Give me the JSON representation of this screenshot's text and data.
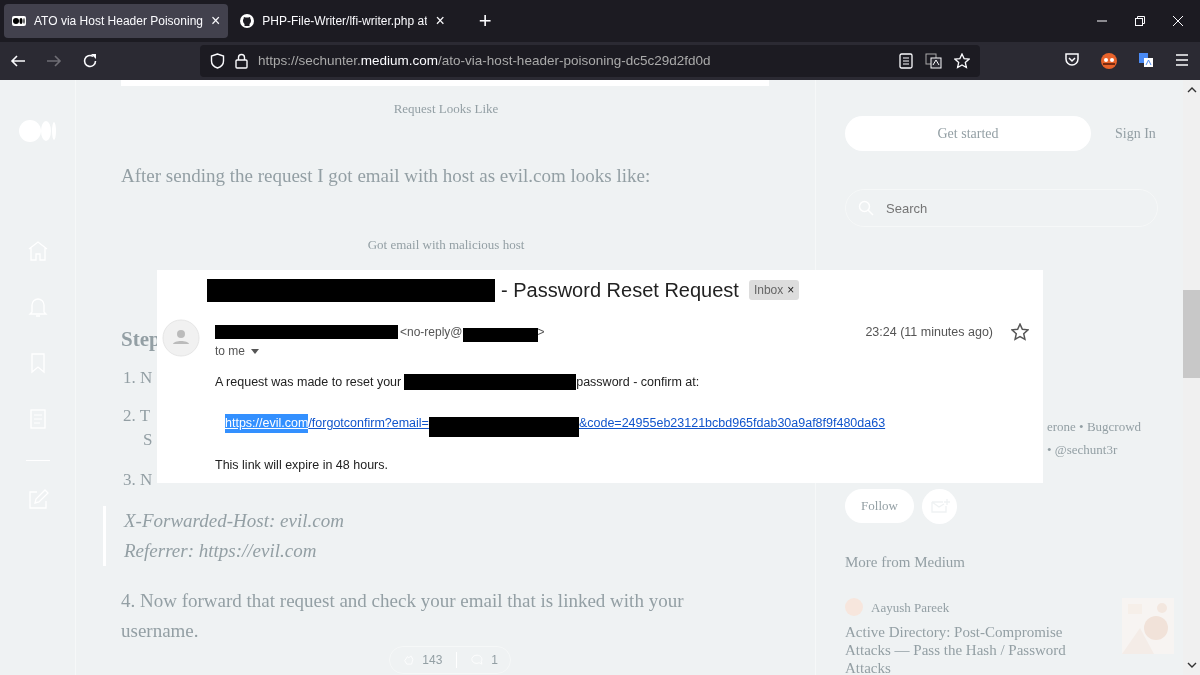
{
  "browser": {
    "tabs": [
      {
        "title": "ATO via Host Header Poisoning",
        "selected": true,
        "close": "×"
      },
      {
        "title": "PHP-File-Writer/lfi-writer.php at",
        "selected": false,
        "close": "×"
      }
    ],
    "new_tab": "+",
    "forward_disabled": true,
    "address": {
      "start": "https://sechunter.",
      "domain": "medium.com",
      "path": "/ato-via-host-header-poisoning-dc5c29d2fd0d"
    }
  },
  "article": {
    "caption_1": "Request Looks Like",
    "paragraph_1": "After sending the request I got email with host as evil.com looks like:",
    "caption_2": "Got email with malicious host",
    "heading_fragment": "Step",
    "list_fragments": [
      "1. N",
      "2. T",
      "S",
      "3. N"
    ],
    "blockquote": [
      "X-Forwarded-Host: evil.com",
      "Referrer: https://evil.com"
    ],
    "paragraph_2": "4. Now forward that request and check your email that is linked with your username.",
    "claps": "143",
    "responses": "1"
  },
  "email": {
    "subject": "- Password Reset Request",
    "label": "Inbox",
    "label_close": "×",
    "sender_start": "<no-reply@",
    "sender_end": ">",
    "recipient": "to me",
    "time": "23:24 (11 minutes ago)",
    "body_start": "A request was made to reset your",
    "body_end": "password - confirm at:",
    "link_parts": [
      {
        "text": "https://evil.com",
        "highlighted": true
      },
      {
        "text": "/forgotconfirm?email=",
        "highlighted": false
      },
      {
        "text": "&code=24955eb23121bcbd965fdab30a9af8f9f480da63",
        "highlighted": false
      }
    ],
    "expiry_note": "This link will expire in 48 hours."
  },
  "sidebar": {
    "get_started": "Get started",
    "sign_in": "Sign In",
    "search": {
      "placeholder": "Search"
    },
    "bio_fragments": [
      "erone • Bugcrowd",
      "• @sechunt3r"
    ],
    "follow": "Follow",
    "more_heading": "More from Medium",
    "stories": [
      {
        "author": "Aayush Pareek",
        "title": "Active Directory: Post-Compromise Attacks — Pass the Hash / Password Attacks",
        "kind": "picture"
      }
    ]
  }
}
